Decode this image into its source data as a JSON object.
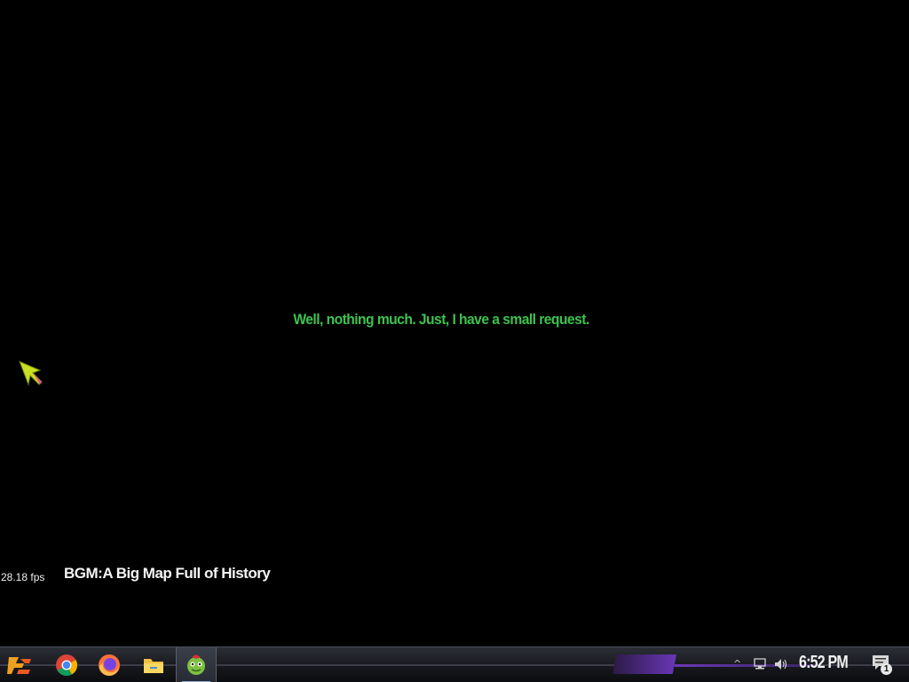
{
  "game": {
    "dialogue": "Well, nothing much. Just, I have a small request.",
    "fps": "28.18 fps",
    "bgm": "BGM:A Big Map Full of History",
    "cursor_icon": "green-arrow-cursor",
    "colors": {
      "dialogue": "#3ec24e",
      "background": "#000000"
    }
  },
  "taskbar": {
    "apps": [
      {
        "name": "Start",
        "icon": "start-logo-icon"
      },
      {
        "name": "Google Chrome",
        "icon": "chrome-icon"
      },
      {
        "name": "Firefox",
        "icon": "firefox-icon"
      },
      {
        "name": "File Explorer",
        "icon": "folder-icon"
      },
      {
        "name": "Game",
        "icon": "zombie-game-icon"
      }
    ],
    "tray": {
      "chevron": "^",
      "clock": "6:52 PM",
      "notification_count": "1"
    },
    "colors": {
      "accent": "#6a37b8"
    }
  }
}
